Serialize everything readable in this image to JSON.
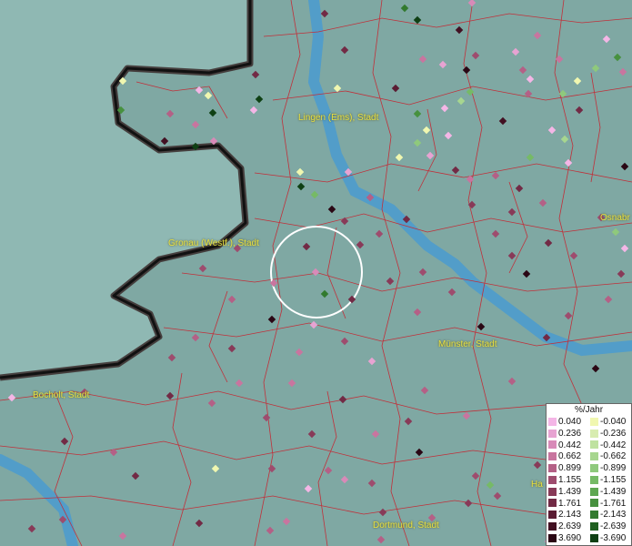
{
  "map": {
    "cities": [
      {
        "name": "Lingen (Ems), Stadt"
      },
      {
        "name": "Gronau (Westf.), Stadt"
      },
      {
        "name": "Münster, Stadt"
      },
      {
        "name": "Bocholt, Stadt"
      },
      {
        "name": "Dortmund, Stadt"
      },
      {
        "name": "Osnabr"
      },
      {
        "name": "Ha"
      }
    ]
  },
  "legend": {
    "title": "%/Jahr",
    "rows": [
      {
        "pos": "0.040",
        "neg": "-0.040",
        "pos_color": "#f4b6e6",
        "neg_color": "#f0f7b0"
      },
      {
        "pos": "0.236",
        "neg": "-0.236",
        "pos_color": "#e7a3d2",
        "neg_color": "#d8ecb0"
      },
      {
        "pos": "0.442",
        "neg": "-0.442",
        "pos_color": "#d88ab8",
        "neg_color": "#bfe2a0"
      },
      {
        "pos": "0.662",
        "neg": "-0.662",
        "pos_color": "#c8759f",
        "neg_color": "#a7d68f"
      },
      {
        "pos": "0.899",
        "neg": "-0.899",
        "pos_color": "#b46086",
        "neg_color": "#8fc97c"
      },
      {
        "pos": "1.155",
        "neg": "-1.155",
        "pos_color": "#9e4c6e",
        "neg_color": "#76ba66"
      },
      {
        "pos": "1.439",
        "neg": "-1.439",
        "pos_color": "#883a58",
        "neg_color": "#5ea751"
      },
      {
        "pos": "1.761",
        "neg": "-1.761",
        "pos_color": "#722a45",
        "neg_color": "#47913f"
      },
      {
        "pos": "2.143",
        "neg": "-2.143",
        "pos_color": "#5a1c33",
        "neg_color": "#327a2e"
      },
      {
        "pos": "2.639",
        "neg": "-2.639",
        "pos_color": "#421022",
        "neg_color": "#206021"
      },
      {
        "pos": "3.690",
        "neg": "-3.690",
        "pos_color": "#2a0714",
        "neg_color": "#0f4014"
      }
    ]
  }
}
